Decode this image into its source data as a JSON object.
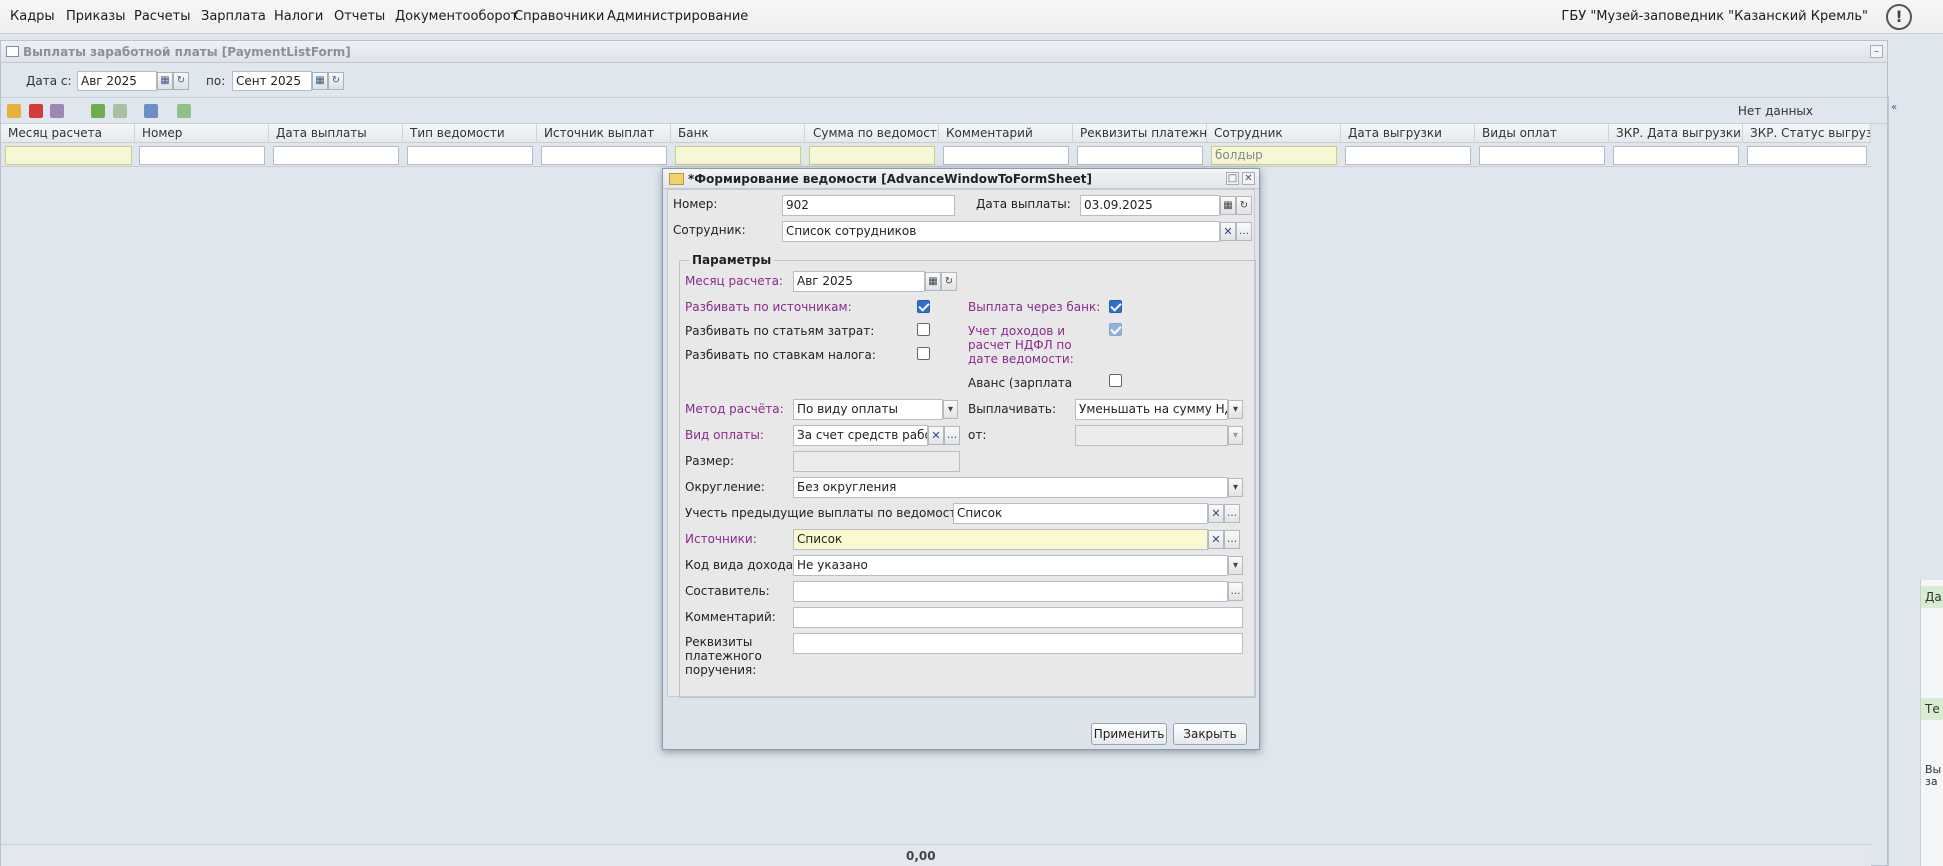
{
  "menu": {
    "items": [
      "Кадры",
      "Приказы",
      "Расчеты",
      "Зарплата",
      "Налоги",
      "Отчеты",
      "Документооборот",
      "Справочники",
      "Администрирование"
    ],
    "org": "ГБУ \"Музей-заповедник \"Казанский Кремль\"",
    "alert_icon": "!"
  },
  "main": {
    "title": "Выплаты заработной платы [PaymentListForm]",
    "date_from_label": "Дата с:",
    "date_from": "Авг 2025",
    "date_to_label": "по:",
    "date_to": "Сент 2025",
    "no_data": "Нет данных",
    "columns": [
      "Месяц расчета",
      "Номер",
      "Дата выплаты",
      "Тип ведомости",
      "Источник выплат",
      "Банк",
      "Сумма по ведомости",
      "Комментарий",
      "Реквизиты платежног...",
      "Сотрудник",
      "Дата выгрузки",
      "Виды оплат",
      "ЗКР. Дата выгрузки",
      "ЗКР. Статус выгрузки"
    ],
    "employee_filter": "болдыр",
    "total": "0,00"
  },
  "right_panel": {
    "tab1": "Да",
    "tab2": "Те",
    "text1": "Вы",
    "text2": "за"
  },
  "dialog": {
    "title": "*Формирование ведомости [AdvanceWindowToFormSheet]",
    "number_label": "Номер:",
    "number": "902",
    "pay_date_label": "Дата выплаты:",
    "pay_date": "03.09.2025",
    "employee_label": "Сотрудник:",
    "employee": "Список сотрудников",
    "params_legend": "Параметры",
    "calc_month_label": "Месяц расчета:",
    "calc_month": "Авг 2025",
    "split_sources_label": "Разбивать по источникам:",
    "split_costs_label": "Разбивать по статьям затрат:",
    "split_tax_label": "Разбивать по ставкам налога:",
    "bank_pay_label": "Выплата через банк:",
    "income_ndfl_label": "Учет доходов и расчет НДФЛ по дате ведомости:",
    "advance_label": "Аванс (зарплата за первую половину",
    "calc_method_label": "Метод расчёта:",
    "calc_method": "По виду оплаты",
    "pay_out_label": "Выплачивать:",
    "pay_out": "Уменьшать на сумму НДФЛ",
    "pay_type_label": "Вид оплаты:",
    "pay_type": "За счет средств работодателя",
    "from_label": "от:",
    "from_value": "",
    "size_label": "Размер:",
    "size_value": "",
    "rounding_label": "Округление:",
    "rounding": "Без округления",
    "prev_payments_label": "Учесть предыдущие выплаты по ведомостям:",
    "prev_payments": "Список",
    "sources_label": "Источники:",
    "sources": "Список",
    "income_code_label": "Код вида дохода:",
    "income_code": "Не указано",
    "composer_label": "Составитель:",
    "composer": "",
    "comment_label": "Комментарий:",
    "comment": "",
    "requisites_label": "Реквизиты платежного поручения:",
    "requisites": "",
    "apply_button": "Применить",
    "close_button": "Закрыть"
  }
}
